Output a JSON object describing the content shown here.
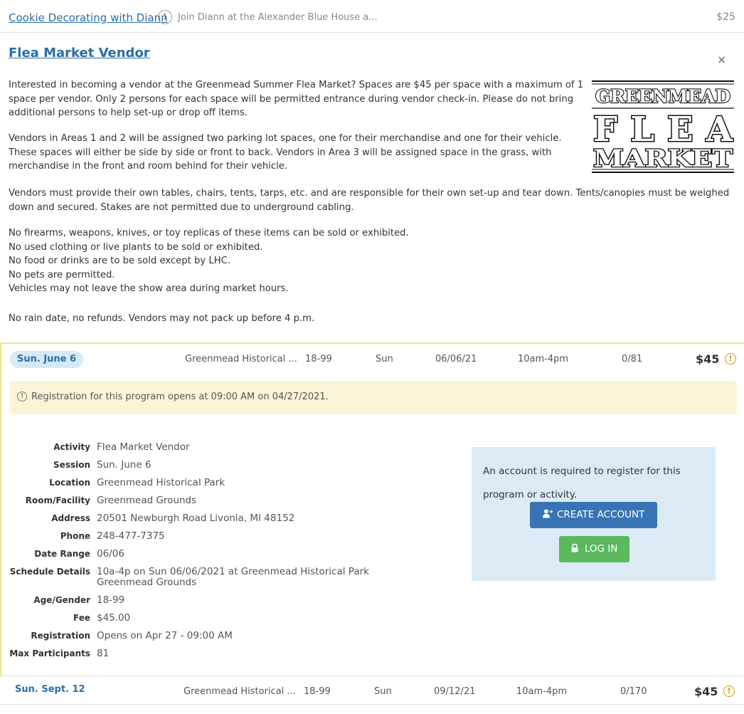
{
  "top_row": {
    "title": "Cookie Decorating with Diann",
    "count": "1",
    "description": "Join Diann at the Alexander Blue House a...",
    "price": "$25"
  },
  "program": {
    "title": "Flea Market Vendor",
    "close": "×",
    "paragraphs": [
      "Interested in becoming a vendor at the Greenmead Summer Flea Market? Spaces are $45 per space with a maximum of 1 space per vendor. Only 2 persons for each space will be permitted entrance during vendor check-in. Please do not bring additional persons to help set-up or drop off items.",
      "Vendors in Areas 1 and 2 will be assigned two parking lot spaces, one for their merchandise and one for their vehicle. These spaces will either be side by side or front to back. Vendors in Area 3 will be assigned space in the grass, with merchandise in the front and room behind for their vehicle.",
      "Vendors must provide their own tables, chairs, tents, tarps, etc. and are responsible for their own set-up and tear down. Tents/canopies must be weighed down and secured. Stakes are not permitted due to underground cabling."
    ],
    "rules": [
      "No firearms, weapons, knives, or toy replicas of these items can be sold or exhibited.",
      "No used clothing or live plants to be sold or exhibited.",
      "No food or drinks are to be sold except by LHC.",
      "No pets are permitted.",
      "Vehicles may not leave the show area during market hours."
    ],
    "final_note": "No rain date, no refunds. Vendors may not pack up before 4 p.m.",
    "logo": {
      "line1": "GREENMEAD",
      "line2": "FLEA",
      "line3": "MARKET"
    }
  },
  "session1": {
    "date": "Sun. June 6",
    "location": "Greenmead Historical ...",
    "ages": "18-99",
    "day": "Sun",
    "dates": "06/06/21",
    "times": "10am-4pm",
    "enrolled": "0/81",
    "price": "$45",
    "notice": "Registration for this program opens at 09:00 AM on 04/27/2021.",
    "details": [
      {
        "label": "Activity",
        "value": "Flea Market Vendor"
      },
      {
        "label": "Session",
        "value": "Sun. June 6"
      },
      {
        "label": "Location",
        "value": "Greenmead Historical Park"
      },
      {
        "label": "Room/Facility",
        "value": "Greenmead Grounds"
      },
      {
        "label": "Address",
        "value": "20501 Newburgh Road Livonia, MI 48152"
      },
      {
        "label": "Phone",
        "value": "248-477-7375"
      },
      {
        "label": "Date Range",
        "value": "06/06"
      },
      {
        "label": "Schedule Details",
        "value": "10a-4p on Sun 06/06/2021 at Greenmead Historical Park",
        "value2": "Greenmead Grounds"
      },
      {
        "label": "Age/Gender",
        "value": "18-99"
      },
      {
        "label": "Fee",
        "value": "$45.00"
      },
      {
        "label": "Registration",
        "value": "Opens on Apr 27 - 09:00 AM"
      },
      {
        "label": "Max Participants",
        "value": "81"
      }
    ],
    "account": {
      "message": "An account is required to register for this program or activity.",
      "create_label": "CREATE ACCOUNT",
      "login_label": "LOG IN"
    }
  },
  "session2": {
    "date": "Sun. Sept. 12",
    "location": "Greenmead Historical ...",
    "ages": "18-99",
    "day": "Sun",
    "dates": "09/12/21",
    "times": "10am-4pm",
    "enrolled": "0/170",
    "price": "$45"
  },
  "colors": {
    "link": "#2a6ea8",
    "notice_bg": "#fbf5d8",
    "account_bg": "#dbeaf5",
    "create_btn": "#3874b5",
    "login_btn": "#5cb85c",
    "warning": "#d29b00"
  },
  "icons": {
    "warning": "exclamation-circle-icon",
    "user_plus": "user-plus-icon",
    "lock": "lock-icon",
    "close": "close-icon"
  }
}
